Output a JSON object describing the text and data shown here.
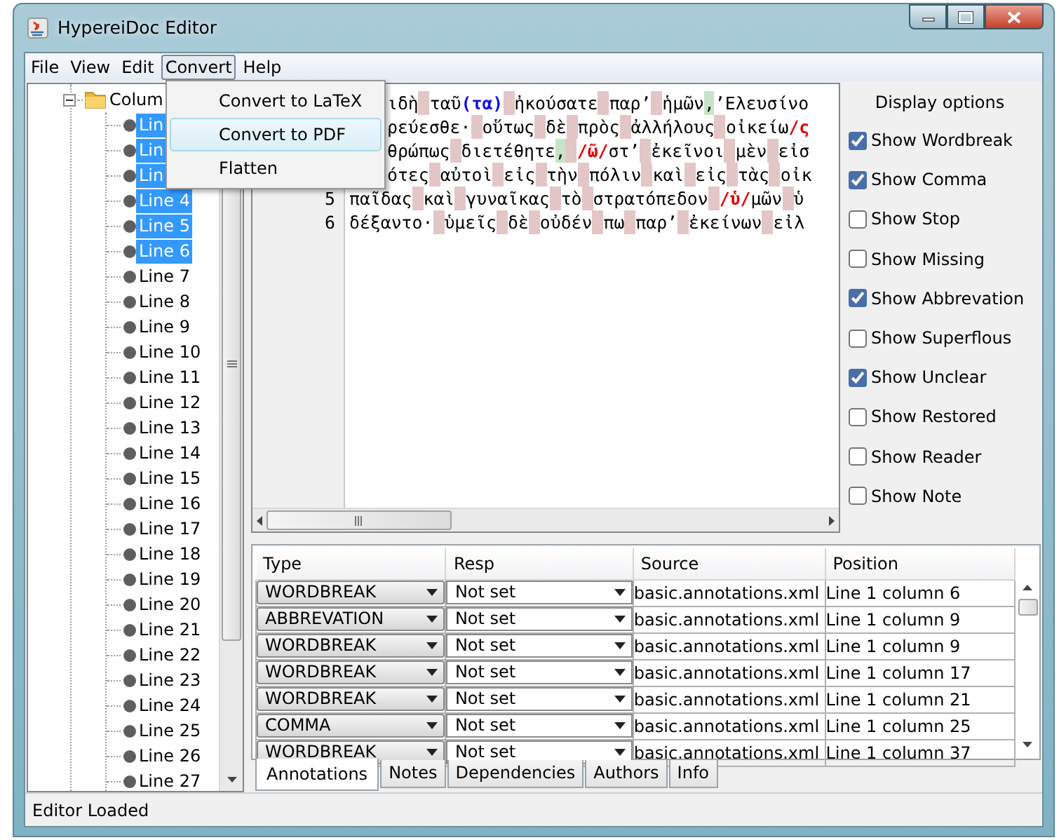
{
  "window": {
    "title": "HypereiDoc Editor"
  },
  "menu": [
    {
      "label": "File",
      "open": false
    },
    {
      "label": "View",
      "open": false
    },
    {
      "label": "Edit",
      "open": false
    },
    {
      "label": "Convert",
      "open": true
    },
    {
      "label": "Help",
      "open": false
    }
  ],
  "dropdown": [
    {
      "label": "Convert to LaTeX",
      "hover": false
    },
    {
      "label": "Convert to PDF",
      "hover": true
    },
    {
      "label": "Flatten",
      "hover": false
    }
  ],
  "tree": {
    "label": "Colum",
    "expanded": true,
    "children": [
      {
        "label": "Lin",
        "selected": true
      },
      {
        "label": "Lin",
        "selected": true
      },
      {
        "label": "Lin",
        "selected": true
      },
      {
        "label": "Line 4",
        "selected": true
      },
      {
        "label": "Line 5",
        "selected": true
      },
      {
        "label": "Line 6",
        "selected": true
      },
      {
        "label": "Line 7",
        "selected": false
      },
      {
        "label": "Line 8",
        "selected": false
      },
      {
        "label": "Line 9",
        "selected": false
      },
      {
        "label": "Line 10",
        "selected": false
      },
      {
        "label": "Line 11",
        "selected": false
      },
      {
        "label": "Line 12",
        "selected": false
      },
      {
        "label": "Line 13",
        "selected": false
      },
      {
        "label": "Line 14",
        "selected": false
      },
      {
        "label": "Line 15",
        "selected": false
      },
      {
        "label": "Line 16",
        "selected": false
      },
      {
        "label": "Line 17",
        "selected": false
      },
      {
        "label": "Line 18",
        "selected": false
      },
      {
        "label": "Line 19",
        "selected": false
      },
      {
        "label": "Line 20",
        "selected": false
      },
      {
        "label": "Line 21",
        "selected": false
      },
      {
        "label": "Line 22",
        "selected": false
      },
      {
        "label": "Line 23",
        "selected": false
      },
      {
        "label": "Line 24",
        "selected": false
      },
      {
        "label": "Line 25",
        "selected": false
      },
      {
        "label": "Line 26",
        "selected": false
      },
      {
        "label": "Line 27",
        "selected": false
      }
    ]
  },
  "editor": {
    "lines": [
      {
        "segments": [
          {
            "kind": "text",
            "text": "ιδὴ"
          },
          {
            "kind": "break"
          },
          {
            "kind": "text",
            "text": "ταῦ"
          },
          {
            "kind": "abbr",
            "text": "(τα)"
          },
          {
            "kind": "break"
          },
          {
            "kind": "text",
            "text": "ἠκούσατε"
          },
          {
            "kind": "break"
          },
          {
            "kind": "text",
            "text": "παρ’"
          },
          {
            "kind": "break"
          },
          {
            "kind": "text",
            "text": "ἡμῶν"
          },
          {
            "kind": "comma",
            "text": ","
          },
          {
            "kind": "text",
            "text": "’Ελευσίνο"
          }
        ]
      },
      {
        "segments": [
          {
            "kind": "text",
            "text": "ρεύεσθε·"
          },
          {
            "kind": "break"
          },
          {
            "kind": "text",
            "text": "οὕτως"
          },
          {
            "kind": "break"
          },
          {
            "kind": "text",
            "text": "δὲ"
          },
          {
            "kind": "break"
          },
          {
            "kind": "text",
            "text": "πρὸς"
          },
          {
            "kind": "break"
          },
          {
            "kind": "text",
            "text": "ἀλλήλους"
          },
          {
            "kind": "break"
          },
          {
            "kind": "text",
            "text": "οἰκείω"
          },
          {
            "kind": "unclear",
            "text": "/ς"
          }
        ]
      },
      {
        "segments": [
          {
            "kind": "text",
            "text": "θρώπως"
          },
          {
            "kind": "break"
          },
          {
            "kind": "text",
            "text": "διετέθητε"
          },
          {
            "kind": "comma",
            "text": ","
          },
          {
            "kind": "break"
          },
          {
            "kind": "unclear",
            "text": "/ῶ/"
          },
          {
            "kind": "text",
            "text": "στ’"
          },
          {
            "kind": "break"
          },
          {
            "kind": "text",
            "text": "ἐκεῖνοι"
          },
          {
            "kind": "break"
          },
          {
            "kind": "text",
            "text": "μὲν"
          },
          {
            "kind": "break"
          },
          {
            "kind": "text",
            "text": "εἰσ"
          }
        ]
      },
      {
        "segments": [
          {
            "kind": "text",
            "text": "ότες"
          },
          {
            "kind": "break"
          },
          {
            "kind": "text",
            "text": "αὐτοὶ"
          },
          {
            "kind": "break"
          },
          {
            "kind": "text",
            "text": "εἰς"
          },
          {
            "kind": "break"
          },
          {
            "kind": "text",
            "text": "τὴν"
          },
          {
            "kind": "break"
          },
          {
            "kind": "text",
            "text": "πόλιν"
          },
          {
            "kind": "break"
          },
          {
            "kind": "text",
            "text": "καὶ"
          },
          {
            "kind": "break"
          },
          {
            "kind": "text",
            "text": "εἰς"
          },
          {
            "kind": "break"
          },
          {
            "kind": "text",
            "text": "τὰς"
          },
          {
            "kind": "break"
          },
          {
            "kind": "text",
            "text": "οἰκ"
          }
        ]
      },
      {
        "number": "5",
        "segments": [
          {
            "kind": "text",
            "text": "παῖδας"
          },
          {
            "kind": "break"
          },
          {
            "kind": "text",
            "text": "καὶ"
          },
          {
            "kind": "break"
          },
          {
            "kind": "text",
            "text": "γυναῖκας"
          },
          {
            "kind": "break"
          },
          {
            "kind": "text",
            "text": "τὸ"
          },
          {
            "kind": "break"
          },
          {
            "kind": "text",
            "text": "στρατόπεδον"
          },
          {
            "kind": "break"
          },
          {
            "kind": "unclear",
            "text": "/ὑ/"
          },
          {
            "kind": "text",
            "text": "μῶν"
          },
          {
            "kind": "break"
          },
          {
            "kind": "text",
            "text": "ὑ"
          }
        ]
      },
      {
        "number": "6",
        "segments": [
          {
            "kind": "text",
            "text": "δέξαντο·"
          },
          {
            "kind": "break"
          },
          {
            "kind": "text",
            "text": "ὑμεῖς"
          },
          {
            "kind": "break"
          },
          {
            "kind": "text",
            "text": "δὲ"
          },
          {
            "kind": "break"
          },
          {
            "kind": "text",
            "text": "οὐδέν"
          },
          {
            "kind": "break"
          },
          {
            "kind": "text",
            "text": "πω"
          },
          {
            "kind": "break"
          },
          {
            "kind": "text",
            "text": "παρ’"
          },
          {
            "kind": "break"
          },
          {
            "kind": "text",
            "text": "ἐκείνων"
          },
          {
            "kind": "break"
          },
          {
            "kind": "text",
            "text": "εἰλ"
          }
        ]
      }
    ]
  },
  "display_options": {
    "title": "Display options",
    "items": [
      {
        "label": "Show Wordbreak",
        "checked": true
      },
      {
        "label": "Show Comma",
        "checked": true
      },
      {
        "label": "Show Stop",
        "checked": false
      },
      {
        "label": "Show Missing",
        "checked": false
      },
      {
        "label": "Show Abbrevation",
        "checked": true
      },
      {
        "label": "Show Superflous",
        "checked": false
      },
      {
        "label": "Show Unclear",
        "checked": true
      },
      {
        "label": "Show Restored",
        "checked": false
      },
      {
        "label": "Show Reader",
        "checked": false
      },
      {
        "label": "Show Note",
        "checked": false
      }
    ]
  },
  "table": {
    "columns": [
      "Type",
      "Resp",
      "Source",
      "Position"
    ],
    "rows": [
      {
        "type": "WORDBREAK",
        "resp": "Not set",
        "source": "basic.annotations.xml",
        "position": "Line 1 column 6"
      },
      {
        "type": "ABBREVATION",
        "resp": "Not set",
        "source": "basic.annotations.xml",
        "position": "Line 1 column 9"
      },
      {
        "type": "WORDBREAK",
        "resp": "Not set",
        "source": "basic.annotations.xml",
        "position": "Line 1 column 9"
      },
      {
        "type": "WORDBREAK",
        "resp": "Not set",
        "source": "basic.annotations.xml",
        "position": "Line 1 column 17"
      },
      {
        "type": "WORDBREAK",
        "resp": "Not set",
        "source": "basic.annotations.xml",
        "position": "Line 1 column 21"
      },
      {
        "type": "COMMA",
        "resp": "Not set",
        "source": "basic.annotations.xml",
        "position": "Line 1 column 25"
      },
      {
        "type": "WORDBREAK",
        "resp": "Not set",
        "source": "basic.annotations.xml",
        "position": "Line 1 column 37"
      }
    ]
  },
  "tabs": [
    {
      "label": "Annotations",
      "selected": true
    },
    {
      "label": "Notes",
      "selected": false
    },
    {
      "label": "Dependencies",
      "selected": false
    },
    {
      "label": "Authors",
      "selected": false
    },
    {
      "label": "Info",
      "selected": false
    }
  ],
  "status_bar": "Editor Loaded"
}
